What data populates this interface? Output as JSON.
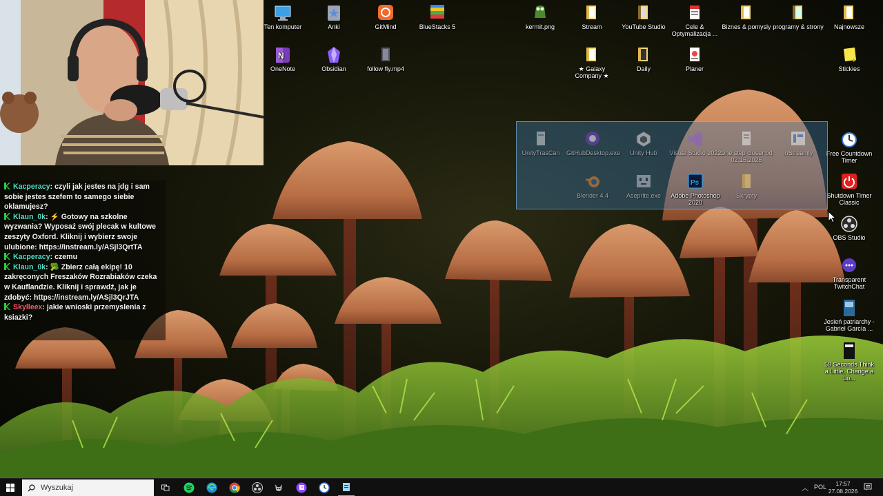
{
  "chat": {
    "messages": [
      {
        "user": "Kacperacy",
        "text": "czyli jak jestes na jdg i sam sobie jestes szefem to samego siebie oklamujesz?",
        "color": "teal"
      },
      {
        "user": "Klaun_0k",
        "text": "⚡ Gotowy na szkolne wyzwania? Wyposaż swój plecak w kultowe zeszyty Oxford. Kliknij i wybierz swoje ulubione: https://instream.ly/ASjl3QrtTA",
        "color": "teal"
      },
      {
        "user": "Kacperacy",
        "text": "czemu",
        "color": "teal"
      },
      {
        "user": "Klaun_0k",
        "text": "🥦 Zbierz całą ekipę! 10 zakręconych Freszaków Rozrabiaków czeka w Kauflandzie. Kliknij i sprawdź, jak je zdobyć: https://instream.ly/ASjl3QrJTA",
        "color": "teal"
      },
      {
        "user": "Skylleex",
        "text": "jakie wnioski przemyslenia z ksiazki?",
        "color": "red"
      }
    ]
  },
  "desktop": {
    "icons": [
      {
        "label": "Ten komputer",
        "icon": "monitor-icon"
      },
      {
        "label": "Anki",
        "icon": "anki-icon"
      },
      {
        "label": "GitMind",
        "icon": "gitmind-icon"
      },
      {
        "label": "BlueStacks 5",
        "icon": "bluestacks-icon"
      },
      {
        "label": "kermit.png",
        "icon": "image-file-icon"
      },
      {
        "label": "Stream",
        "icon": "folder-icon"
      },
      {
        "label": "YouTube Studio",
        "icon": "folder-icon"
      },
      {
        "label": "Cele & Optymalizacja ...",
        "icon": "document-icon"
      },
      {
        "label": "Biznes & pomysly",
        "icon": "folder-icon"
      },
      {
        "label": "programy & strony",
        "icon": "folder-icon"
      },
      {
        "label": "Najnowsze",
        "icon": "folder-icon"
      },
      {
        "label": "OneNote",
        "icon": "onenote-icon"
      },
      {
        "label": "Obsidian",
        "icon": "obsidian-icon"
      },
      {
        "label": "follow fly.mp4",
        "icon": "video-file-icon"
      },
      {
        "label": "★ Galaxy Company ★",
        "icon": "folder-icon"
      },
      {
        "label": "Daily",
        "icon": "folder-icon"
      },
      {
        "label": "Planer",
        "icon": "document-icon"
      },
      {
        "label": "Stickies",
        "icon": "sticky-note-icon"
      },
      {
        "label": "Free Countdown Timer",
        "icon": "timer-icon"
      },
      {
        "label": "Shutdown Timer Classic",
        "icon": "power-icon"
      },
      {
        "label": "OBS Studio",
        "icon": "obs-icon"
      },
      {
        "label": "Transparent TwitchChat",
        "icon": "chat-icon"
      },
      {
        "label": "Jesień patriarchy - Gabriel García ...",
        "icon": "book-icon"
      },
      {
        "label": "59 Seconds Think a Little, Change a Lo...",
        "icon": "book-icon"
      }
    ],
    "fence_icons": [
      {
        "label": "UnityTrasCan",
        "icon": "document-icon"
      },
      {
        "label": "GitHubDesktop.exe",
        "icon": "github-icon"
      },
      {
        "label": "Unity Hub",
        "icon": "unity-icon"
      },
      {
        "label": "Visual Studio 2022",
        "icon": "visual-studio-icon"
      },
      {
        "label": "One step closer od 02.15.2026",
        "icon": "document-icon"
      },
      {
        "label": "inStreamly",
        "icon": "instreamly-icon"
      },
      {
        "label": "Blender 4.4",
        "icon": "blender-icon"
      },
      {
        "label": "Aseprite.exe",
        "icon": "aseprite-icon"
      },
      {
        "label": "Adobe Photoshop 2020",
        "icon": "photoshop-icon"
      },
      {
        "label": "Skrypty",
        "icon": "folder-icon"
      }
    ]
  },
  "taskbar": {
    "search_placeholder": "Wyszukaj",
    "pinned": [
      "task-view-icon",
      "spotify-icon",
      "edge-icon",
      "chrome-icon",
      "obs-icon",
      "gimp-icon",
      "twitch-icon",
      "clock-app-icon",
      "notepad-icon"
    ],
    "language": "POL",
    "time": "17:57",
    "date": "27.08.2026"
  },
  "colors": {
    "chat_user": "#4fe0c8",
    "chat_user_alt": "#ff5a6a",
    "fence_bg": "#3c78aa",
    "taskbar_bg": "#101010"
  }
}
